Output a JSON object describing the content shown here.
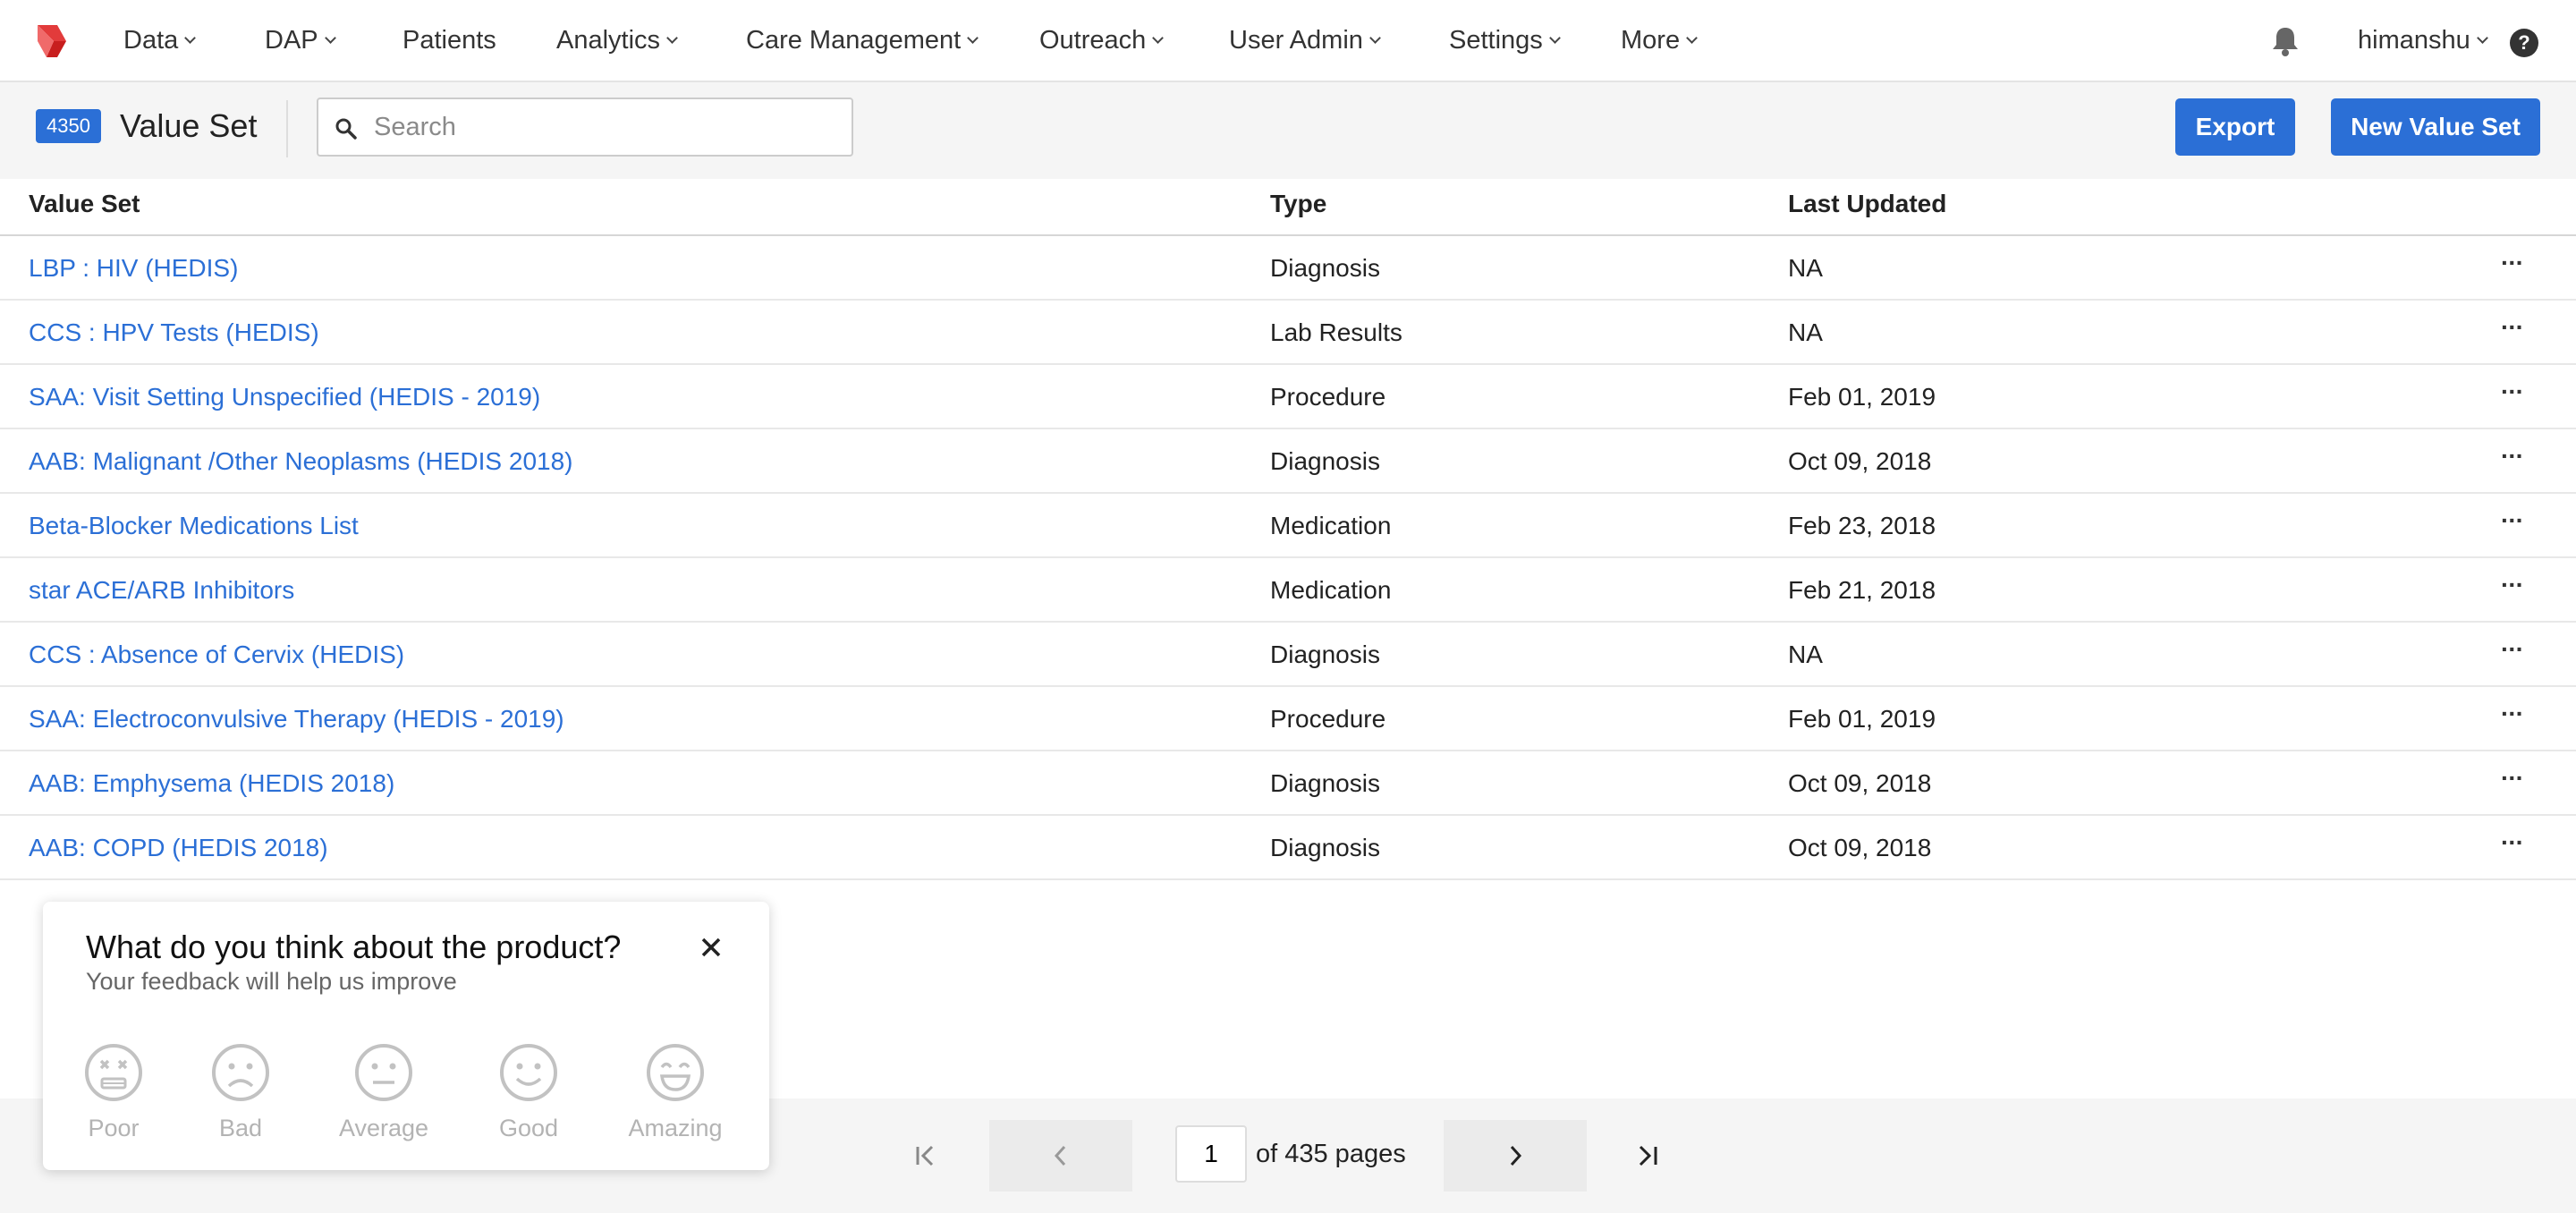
{
  "nav": {
    "items": [
      {
        "label": "Data",
        "dropdown": true
      },
      {
        "label": "DAP",
        "dropdown": true
      },
      {
        "label": "Patients",
        "dropdown": false
      },
      {
        "label": "Analytics",
        "dropdown": true
      },
      {
        "label": "Care Management",
        "dropdown": true
      },
      {
        "label": "Outreach",
        "dropdown": true
      },
      {
        "label": "User Admin",
        "dropdown": true
      },
      {
        "label": "Settings",
        "dropdown": true
      },
      {
        "label": "More",
        "dropdown": true
      }
    ],
    "user": "himanshu",
    "help_label": "?",
    "brand_color": "#d93a3a"
  },
  "header": {
    "count": "4350",
    "title": "Value Set",
    "search_placeholder": "Search",
    "export_label": "Export",
    "new_label": "New Value Set",
    "accent": "#2b6fd6"
  },
  "table": {
    "columns": [
      "Value Set",
      "Type",
      "Last Updated"
    ],
    "rows": [
      {
        "name": "LBP : HIV (HEDIS)",
        "type": "Diagnosis",
        "updated": "NA",
        "menu": "···"
      },
      {
        "name": "CCS : HPV Tests (HEDIS)",
        "type": "Lab Results",
        "updated": "NA",
        "menu": "···"
      },
      {
        "name": "SAA: Visit Setting Unspecified (HEDIS - 2019)",
        "type": "Procedure",
        "updated": "Feb 01, 2019",
        "menu": "···"
      },
      {
        "name": "AAB: Malignant /Other Neoplasms (HEDIS 2018)",
        "type": "Diagnosis",
        "updated": "Oct 09, 2018",
        "menu": "···"
      },
      {
        "name": "Beta-Blocker Medications List",
        "type": "Medication",
        "updated": "Feb 23, 2018",
        "menu": "···"
      },
      {
        "name": "star ACE/ARB Inhibitors",
        "type": "Medication",
        "updated": "Feb 21, 2018",
        "menu": "···"
      },
      {
        "name": "CCS : Absence of Cervix (HEDIS)",
        "type": "Diagnosis",
        "updated": "NA",
        "menu": "···"
      },
      {
        "name": "SAA: Electroconvulsive Therapy (HEDIS - 2019)",
        "type": "Procedure",
        "updated": "Feb 01, 2019",
        "menu": "···"
      },
      {
        "name": "AAB: Emphysema (HEDIS 2018)",
        "type": "Diagnosis",
        "updated": "Oct 09, 2018",
        "menu": "···"
      },
      {
        "name": "AAB: COPD (HEDIS 2018)",
        "type": "Diagnosis",
        "updated": "Oct 09, 2018",
        "menu": "···"
      }
    ]
  },
  "pagination": {
    "current_page": "1",
    "of_text": "of 435 pages"
  },
  "feedback": {
    "title": "What do you think about the product?",
    "subtitle": "Your feedback will help us improve",
    "ratings": [
      "Poor",
      "Bad",
      "Average",
      "Good",
      "Amazing"
    ]
  }
}
